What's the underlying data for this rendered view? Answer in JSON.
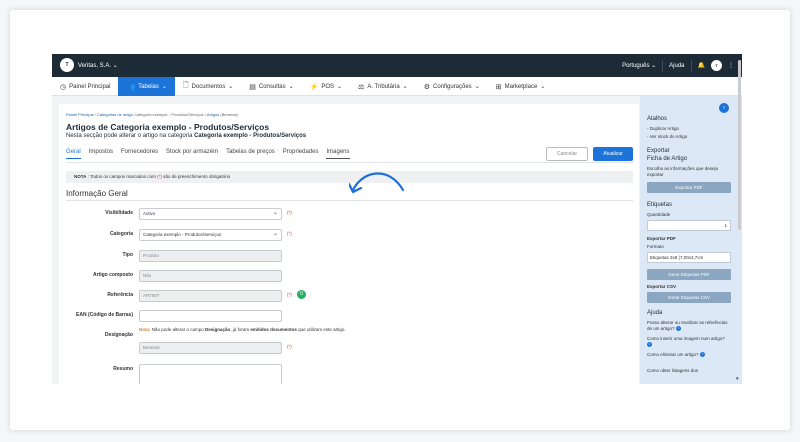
{
  "topbar": {
    "logo_text": "T",
    "company": "Veritas, S.A.",
    "company_caret": "⌄",
    "language": "Português",
    "language_caret": "⌄",
    "help": "Ajuda",
    "bell": "🔔",
    "avatar": "T",
    "more": "⋮"
  },
  "nav": {
    "items": [
      {
        "label": "Painel Principal",
        "icon": "◷"
      },
      {
        "label": "Tabelas",
        "icon": "👥",
        "caret": "⌄"
      },
      {
        "label": "Documentos",
        "icon": "🗋",
        "caret": "⌄"
      },
      {
        "label": "Consultas",
        "icon": "▤",
        "caret": "⌄"
      },
      {
        "label": "POS",
        "icon": "⚡",
        "caret": "⌄"
      },
      {
        "label": "A. Tributária",
        "icon": "⚖",
        "caret": "⌄"
      },
      {
        "label": "Configurações",
        "icon": "⚙",
        "caret": "⌄"
      },
      {
        "label": "Marketplace",
        "icon": "⊞",
        "caret": "⌄"
      }
    ]
  },
  "breadcrumb": {
    "a": "Painel Principal",
    "b": "Categorias de artigo",
    "c": "Categoria exemplo - Produtos/Serviços",
    "d": "Artigos",
    "e": "(Beneras)"
  },
  "page": {
    "title": "Artigos de Categoria exemplo - Produtos/Serviços",
    "subtitle_pre": "Nesta secção pode alterar o artigo  na categoria ",
    "subtitle_bold": "Categoria exemplo - Produtos/Serviços"
  },
  "tabs": [
    "Geral",
    "Impostos",
    "Fornecedores",
    "Stock por armazém",
    "Tabelas de preços",
    "Propriedades",
    "Imagens"
  ],
  "buttons": {
    "cancel": "Cancelar",
    "update": "Atualizar"
  },
  "note": {
    "prefix": "NOTA",
    "text1": " : Todos os campos marcados com ",
    "req": "(*)",
    "text2": " são de preenchimento obrigatório"
  },
  "section_title": "Informação Geral",
  "form": {
    "visibilidade": {
      "label": "Visibilidade",
      "value": "Activo"
    },
    "categoria": {
      "label": "Categoria",
      "value": "Categoria exemplo - Produtos/Serviços"
    },
    "tipo": {
      "label": "Tipo",
      "value": "Produto"
    },
    "composto": {
      "label": "Artigo composto",
      "value": "Não"
    },
    "referencia": {
      "label": "Referência",
      "value": "ART007"
    },
    "ean": {
      "label": "EAN (Código de Barras)",
      "value": ""
    },
    "designacao": {
      "label": "Designação",
      "value": "Beneras"
    },
    "resumo": {
      "label": "Resumo"
    },
    "req": "(*)",
    "badge_count": "0"
  },
  "warning": {
    "label": "Nota:",
    "t1": " Não pode alterar o campo ",
    "b1": "Designação",
    "t2": ", já foram ",
    "b2": "emitidos documentos",
    "t3": " que utilizam este artigo."
  },
  "sidebar": {
    "collapse": "›",
    "atalhos": "Atalhos",
    "duplicar": "- Duplicar Artigo",
    "ver_stock": "- Ver stock do Artigo",
    "exportar": "Exportar",
    "ficha": "Ficha de Artigo",
    "exportar_desc": "Escolha as informações que deseja exportar",
    "exportar_pdf_btn": "Exportar PDF",
    "etiquetas": "Etiquetas",
    "quantidade_label": "Quantidade",
    "quantidade_value": "1",
    "exportar_pdf_title": "Exportar PDF",
    "formato_label": "Formato",
    "formato_value": "Etiquetas 3x8 (7,00x3,7cm",
    "gerar_pdf_btn": "Gerar Etiquetas PDF",
    "exportar_csv": "Exportar CSV",
    "gerar_csv_btn": "Gerar Etiquetas CSV",
    "ajuda": "Ajuda",
    "q1": "Posso alterar ou reutilizar as referências de um artigo?",
    "q2": "Como inserir uma imagem num artigo?",
    "q3": "Como eliminar um artigo?",
    "q4": "Como obter listagens dos"
  },
  "colors": {
    "accent": "#1d74d8",
    "topbar": "#1c2b36",
    "sidebar": "#dce8f5"
  }
}
